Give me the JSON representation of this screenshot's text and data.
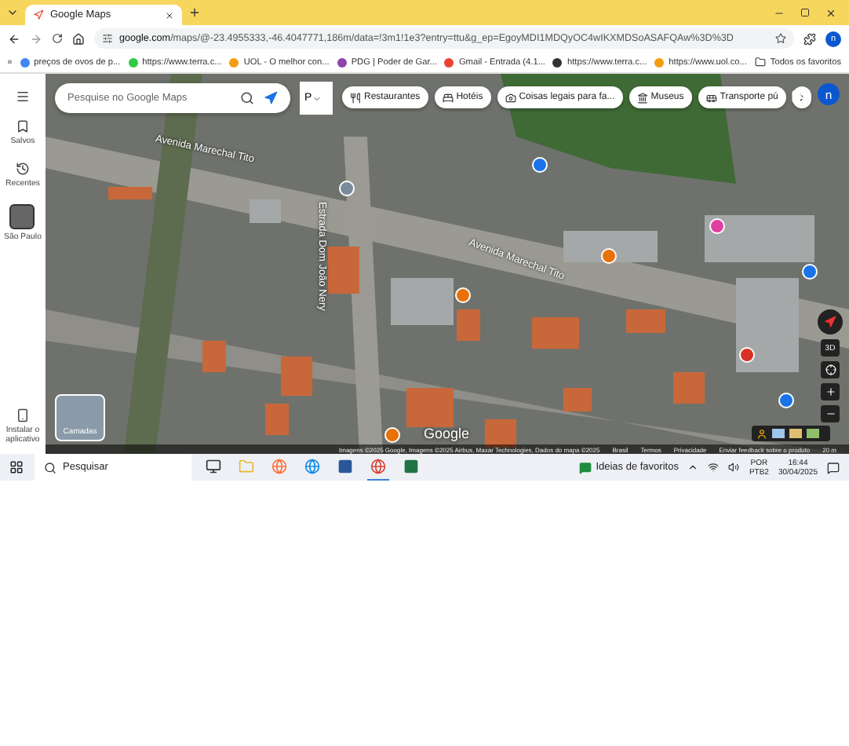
{
  "browser": {
    "tab_title": "Google Maps",
    "url_domain": "google.com",
    "url_path": "/maps/@-23.4955333,-46.4047771,186m/data=!3m1!1e3?entry=ttu&g_ep=EgoyMDI1MDQyOC4wIKXMDSoASAFQAw%3D%3D",
    "avatar": "n",
    "bookmarks": [
      {
        "label": "preços de ovos de p...",
        "color": "#4285f4"
      },
      {
        "label": "https://www.terra.c...",
        "color": "#2ecc40"
      },
      {
        "label": "UOL - O melhor con...",
        "color": "#f39c12"
      },
      {
        "label": "PDG | Poder de Gar...",
        "color": "#8e44ad"
      },
      {
        "label": "Gmail - Entrada (4.1...",
        "color": "#ea4335"
      },
      {
        "label": "https://www.terra.c...",
        "color": "#333333"
      },
      {
        "label": "https://www.uol.co...",
        "color": "#f39c12"
      }
    ],
    "all_bookmarks": "Todos os favoritos"
  },
  "maps": {
    "search_placeholder": "Pesquise no Google Maps",
    "layer_select": "P",
    "sidebar": [
      {
        "kind": "saved",
        "label": "Salvos"
      },
      {
        "kind": "recent",
        "label": "Recentes"
      },
      {
        "kind": "place",
        "label": "São Paulo"
      }
    ],
    "install": "Instalar o aplicativo",
    "chips": [
      {
        "kind": "restaurant",
        "label": "Restaurantes"
      },
      {
        "kind": "hotel",
        "label": "Hotéis"
      },
      {
        "kind": "camera",
        "label": "Coisas legais para fa..."
      },
      {
        "kind": "museum",
        "label": "Museus"
      },
      {
        "kind": "transit",
        "label": "Transporte pú"
      }
    ],
    "avatar": "n",
    "streets": [
      "Avenida Marechal Tito",
      "Avenida Marechal Tito",
      "Estrada Dom João Nery"
    ],
    "pins": [
      {
        "color": "#1a73e8"
      },
      {
        "color": "#e040a0"
      },
      {
        "color": "#e8710a"
      },
      {
        "color": "#7a8a9a"
      },
      {
        "color": "#e8710a"
      },
      {
        "color": "#1a73e8"
      },
      {
        "color": "#1a73e8"
      },
      {
        "color": "#e8710a"
      },
      {
        "color": "#d93025"
      }
    ],
    "layers": "Camadas",
    "logo": "Google",
    "view_3d": "3D",
    "attribution": [
      "Imagens ©2025 Google, Imagens ©2025 Airbus, Maxar Technologies, Dados do mapa ©2025",
      "Brasil",
      "Termos",
      "Privacidade",
      "Enviar feedback sobre o produto",
      "20 m"
    ]
  },
  "taskbar": {
    "search": "Pesquisar",
    "widget": "Ideias de favoritos",
    "lang": "POR",
    "layout": "PTB2",
    "time": "16:44",
    "date": "30/04/2025",
    "apps": [
      {
        "kind": "taskview",
        "active": false
      },
      {
        "kind": "folder",
        "active": false
      },
      {
        "kind": "firefox",
        "active": false
      },
      {
        "kind": "edge",
        "active": false
      },
      {
        "kind": "word",
        "active": false
      },
      {
        "kind": "chrome",
        "active": true
      },
      {
        "kind": "excel",
        "active": false
      }
    ]
  }
}
